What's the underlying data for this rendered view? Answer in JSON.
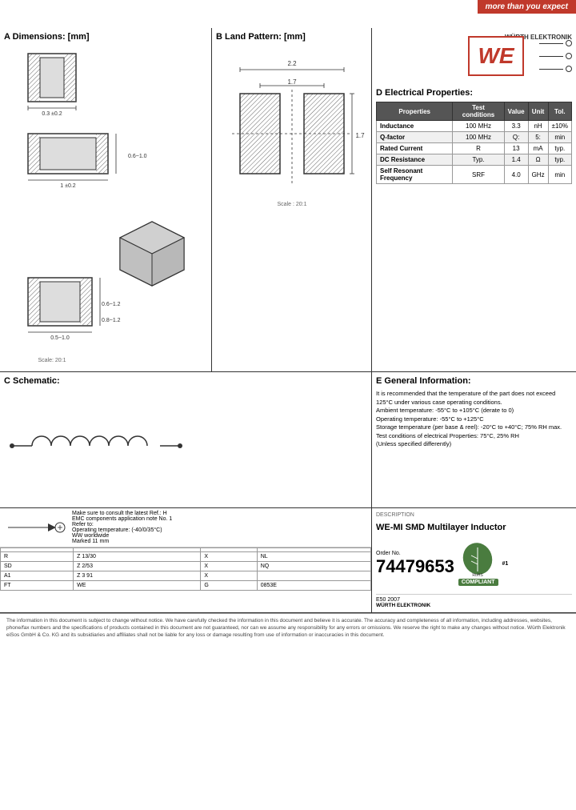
{
  "header": {
    "tagline": "more than you expect"
  },
  "sectionA": {
    "title": "A Dimensions: [mm]",
    "dims": [
      {
        "label": "0.3 ±0.2"
      },
      {
        "label": "1 ±0.2"
      },
      {
        "label": "0.6 ~1.0"
      },
      {
        "label": "0.5 ~1.0"
      },
      {
        "label": "0.6 ~1.2"
      },
      {
        "label": "0.8 ~1.2"
      }
    ],
    "scale_top": "Scale : 20:1",
    "scale_bottom": "Scale : 20:1"
  },
  "sectionB": {
    "title": "B Land Pattern: [mm]",
    "dim1": "2.2",
    "dim2": "1.7",
    "dim3": "1.7",
    "scale": "Scale : 20:1"
  },
  "logo": {
    "we": "WE",
    "brand": "WÜRTH ELEKTRONIK"
  },
  "sectionD": {
    "title": "D Electrical Properties:",
    "headers": [
      "Properties",
      "Test conditions",
      "Value",
      "Unit",
      "Tol."
    ],
    "rows": [
      [
        "Inductance",
        "100 MHz",
        "3.3",
        "nH",
        "±10%"
      ],
      [
        "Q-factor",
        "100 MHz",
        "Q:",
        "5:",
        "min"
      ],
      [
        "Rated Current",
        "R",
        "13",
        "mA",
        "typ."
      ],
      [
        "DC Resistance",
        "Typ.",
        "1.4",
        "Ω",
        "typ."
      ],
      [
        "Self Resonant Frequency",
        "SRF",
        "4.0",
        "GHz",
        "min"
      ]
    ]
  },
  "sectionC": {
    "title": "C Schematic:"
  },
  "sectionE": {
    "title": "E General Information:",
    "text": "It is recommended that the temperature of the part does not exceed 125°C under various case operating conditions.\nAmbient temperature: -55°C to +105°C (derate to 0)\nOperating temperature: -55°C to +125°C\nStorage temperature (per base & reel): -20°C to +40°C; 75% RH max.\nTest conditions of electrical Properties: 75°C, 25% RH\n(Unless specified differently)"
  },
  "sectionBOM": {
    "headers": [
      "",
      "",
      "",
      ""
    ],
    "rows": [
      [
        "R",
        "Z 13/30",
        "X",
        "NL"
      ],
      [
        "SD",
        "Z 2/53",
        "X",
        "NQ"
      ],
      [
        "A1",
        "Z 3 91",
        "X",
        ""
      ],
      [
        "FT",
        "WE",
        "G",
        "0853E"
      ]
    ],
    "notes": {
      "line1": "Make sure to consult the latest Ref.:H",
      "line2": "EMC components application note No. 1",
      "line3": "Refer to:",
      "line4": "Operating temperature: (-40/0/35°C)",
      "line5": "WW worldwide",
      "line6": "Marked 11 mm"
    }
  },
  "partInfo": {
    "description": "DESCRIPTION",
    "name": "WE-MI SMD Multilayer Inductor",
    "orderCode_label": "Order No.",
    "orderCode": "74479653",
    "date": "E50 2007",
    "compliant": "COMPLIANT",
    "rohs": "RoHS",
    "rev": "#1",
    "we_brand": "WÜRTH ELEKTRONIK"
  },
  "footer": {
    "text": "The information in this document is subject to change without notice. We have carefully checked the information in this document and believe it is accurate. The accuracy and completeness of all information, including addresses, websites, phone/fax numbers and the specifications of products contained in this document are not guaranteed, nor can we assume any responsibility for any errors or omissions. We reserve the right to make any changes without notice. Würth Elektronik eiSos GmbH & Co. KG and its subsidiaries and affiliates shall not be liable for any loss or damage resulting from use of information or inaccuracies in this document."
  }
}
